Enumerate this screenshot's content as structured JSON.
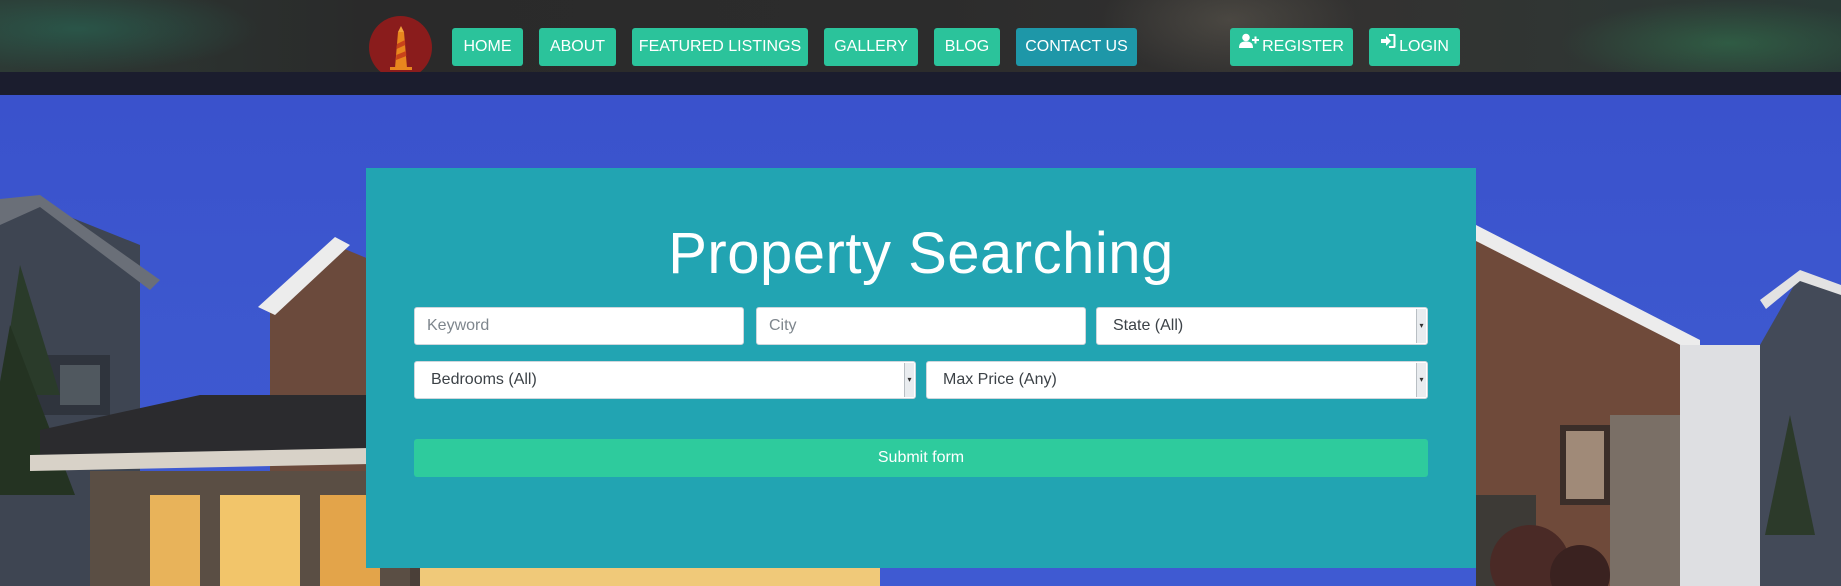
{
  "nav": {
    "items": [
      {
        "label": "HOME"
      },
      {
        "label": "ABOUT"
      },
      {
        "label": "FEATURED LISTINGS"
      },
      {
        "label": "GALLERY"
      },
      {
        "label": "BLOG"
      },
      {
        "label": "CONTACT US"
      }
    ],
    "register_label": "REGISTER",
    "login_label": "LOGIN"
  },
  "search": {
    "title": "Property Searching",
    "keyword_placeholder": "Keyword",
    "city_placeholder": "City",
    "state_value": "State (All)",
    "bedrooms_value": "Bedrooms (All)",
    "max_price_value": "Max Price (Any)",
    "submit_label": "Submit form"
  },
  "colors": {
    "nav_button": "#2bc39b",
    "nav_button_active": "#1e97a8",
    "panel": "#22a4b2",
    "submit": "#2ecb9d",
    "hero_sky": "#3a53cc"
  }
}
